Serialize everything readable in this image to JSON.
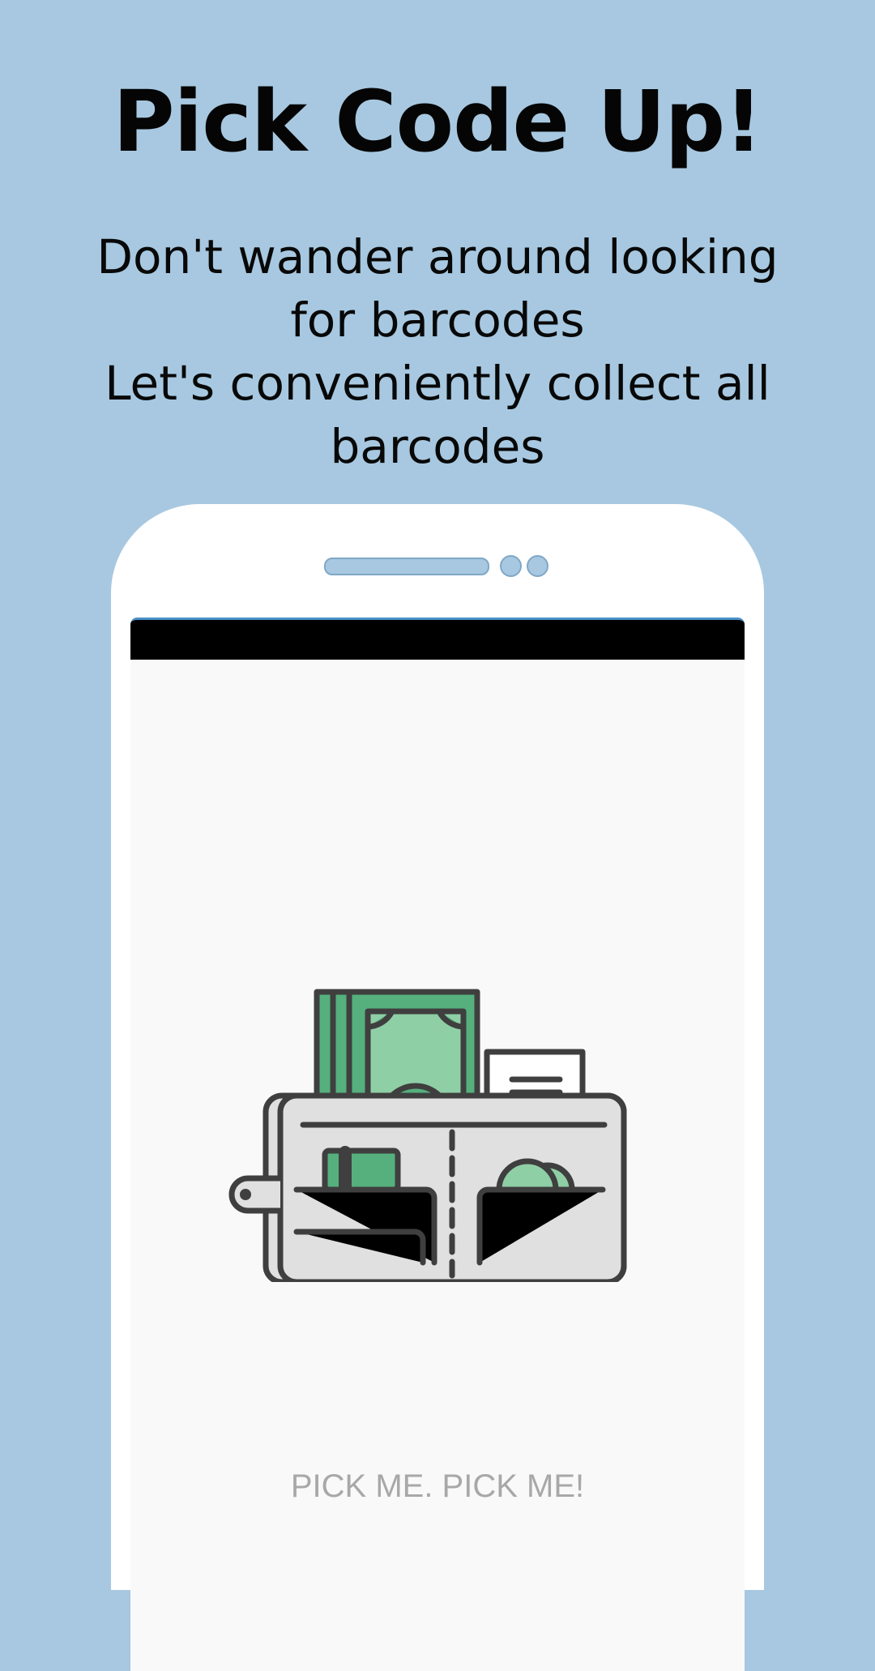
{
  "title": "Pick Code Up!",
  "subtitle": {
    "line1": "Don't wander around looking",
    "line2": "for barcodes",
    "line3": "Let's conveniently collect all",
    "line4": "barcodes"
  },
  "phone_screen": {
    "illustration": "wallet-icon",
    "tagline": "PICK ME. PICK ME!"
  },
  "colors": {
    "background": "#a7c8e0",
    "money_green": "#55b07e",
    "money_light": "#8fcfa6",
    "outline": "#3f3f3f",
    "wallet_fill": "#e0e0e0"
  }
}
